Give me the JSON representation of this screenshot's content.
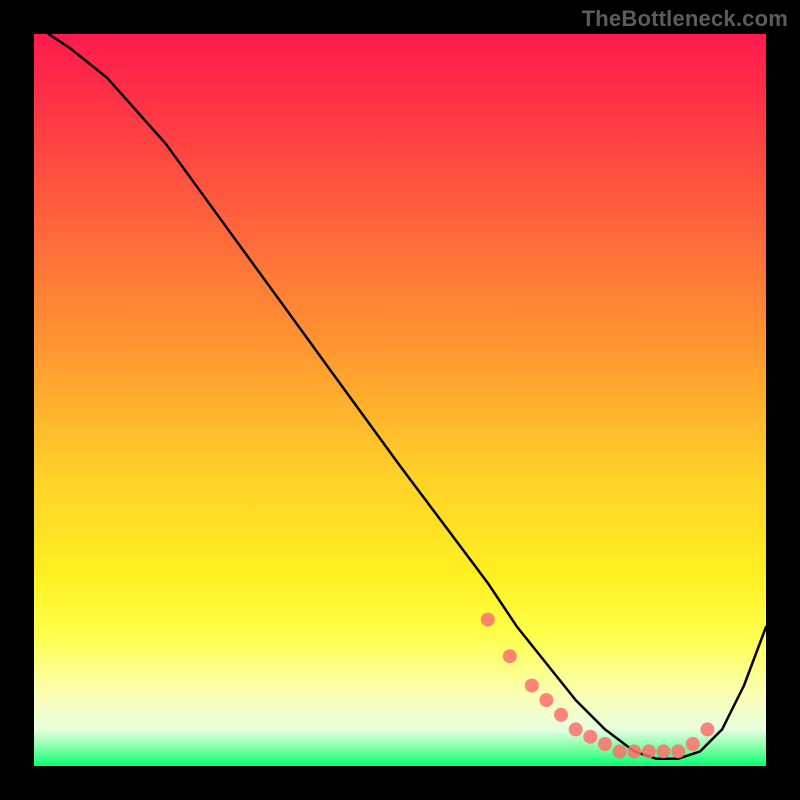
{
  "watermark": "TheBottleneck.com",
  "chart_data": {
    "type": "line",
    "title": "",
    "xlabel": "",
    "ylabel": "",
    "xlim": [
      0,
      100
    ],
    "ylim": [
      0,
      100
    ],
    "grid": false,
    "legend": false,
    "background_gradient": {
      "top": "#ff1a4d",
      "middle": "#ffe030",
      "bottom": "#00ff73"
    },
    "series": [
      {
        "name": "bottleneck-curve",
        "color": "#000000",
        "x": [
          2,
          5,
          10,
          18,
          26,
          34,
          42,
          50,
          56,
          62,
          66,
          70,
          74,
          78,
          82,
          85,
          88,
          91,
          94,
          97,
          100
        ],
        "y": [
          100,
          98,
          94,
          85,
          74,
          63,
          52,
          41,
          33,
          25,
          19,
          14,
          9,
          5,
          2,
          1,
          1,
          2,
          5,
          11,
          19
        ]
      },
      {
        "name": "highlight-dots",
        "type": "scatter",
        "color": "#ff6e6e",
        "x": [
          62,
          65,
          68,
          70,
          72,
          74,
          76,
          78,
          80,
          82,
          84,
          86,
          88,
          90,
          92
        ],
        "y": [
          20,
          15,
          11,
          9,
          7,
          5,
          4,
          3,
          2,
          2,
          2,
          2,
          2,
          3,
          5
        ]
      }
    ]
  }
}
